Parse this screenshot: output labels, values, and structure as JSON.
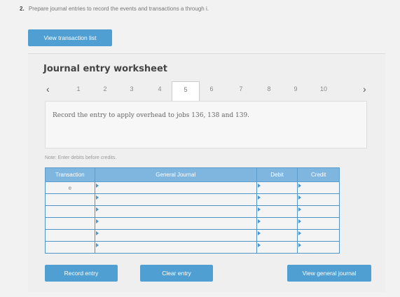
{
  "question": {
    "number": "2.",
    "text": "Prepare journal entries to record the events and transactions a through i."
  },
  "buttons": {
    "view_transaction_list": "View transaction list",
    "record_entry": "Record entry",
    "clear_entry": "Clear entry",
    "view_general_journal": "View general journal"
  },
  "worksheet": {
    "title": "Journal entry worksheet",
    "tabs": [
      "1",
      "2",
      "3",
      "4",
      "5",
      "6",
      "7",
      "8",
      "9",
      "10"
    ],
    "active_tab": "5",
    "instruction": "Record the entry to apply overhead to jobs 136, 138 and 139.",
    "note": "Note: Enter debits before credits."
  },
  "table": {
    "headers": [
      "Transaction",
      "General Journal",
      "Debit",
      "Credit"
    ],
    "rows": [
      {
        "transaction": "e",
        "account": "",
        "debit": "",
        "credit": ""
      },
      {
        "transaction": "",
        "account": "",
        "debit": "",
        "credit": ""
      },
      {
        "transaction": "",
        "account": "",
        "debit": "",
        "credit": ""
      },
      {
        "transaction": "",
        "account": "",
        "debit": "",
        "credit": ""
      },
      {
        "transaction": "",
        "account": "",
        "debit": "",
        "credit": ""
      },
      {
        "transaction": "",
        "account": "",
        "debit": "",
        "credit": ""
      }
    ]
  },
  "colors": {
    "button_bg": "#4f9fd2",
    "table_header_bg": "#7fb6e0"
  }
}
